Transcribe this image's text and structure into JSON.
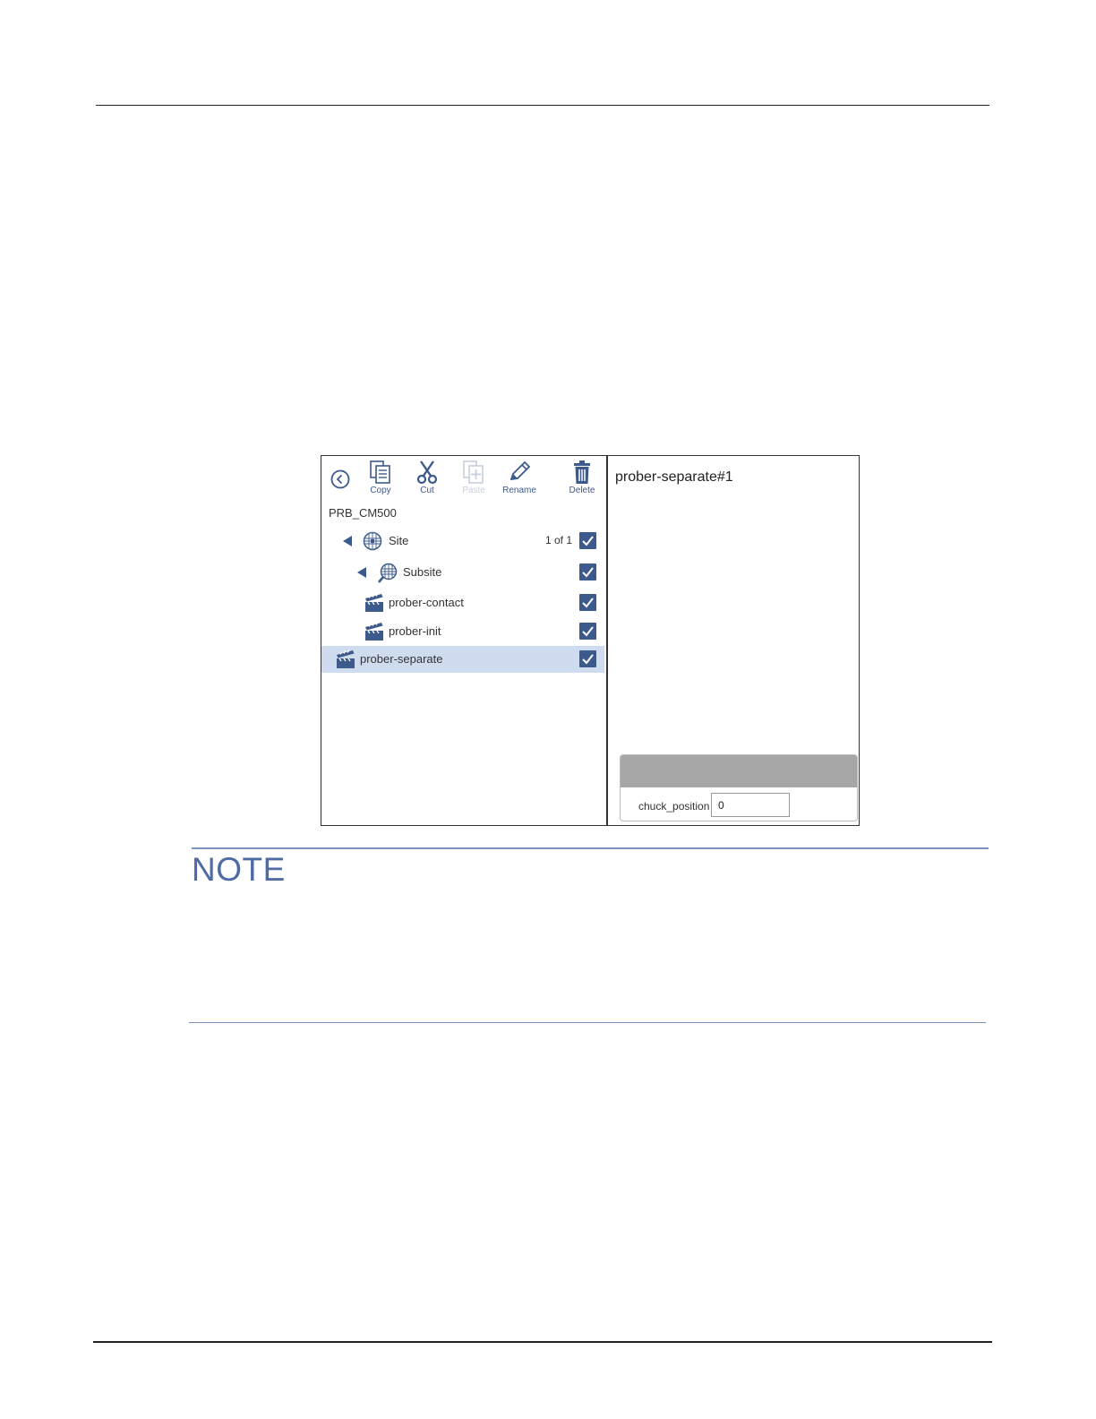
{
  "toolbar": {
    "copy_label": "Copy",
    "cut_label": "Cut",
    "paste_label": "Paste",
    "rename_label": "Rename",
    "delete_label": "Delete"
  },
  "tree": {
    "root": "PRB_CM500",
    "site": {
      "label": "Site",
      "count": "1 of 1",
      "checked": true
    },
    "subsite": {
      "label": "Subsite",
      "checked": true
    },
    "items": [
      {
        "label": "prober-contact",
        "checked": true
      },
      {
        "label": "prober-init",
        "checked": true
      },
      {
        "label": "prober-separate",
        "checked": true,
        "selected": true
      }
    ]
  },
  "details": {
    "title": "prober-separate#1",
    "param_label": "chuck_position",
    "param_value": "0"
  },
  "note": {
    "title": "NOTE"
  },
  "colors": {
    "accent": "#3d5a8c",
    "selected_row": "#cfdcef",
    "note_blue": "#4e6ba6"
  }
}
